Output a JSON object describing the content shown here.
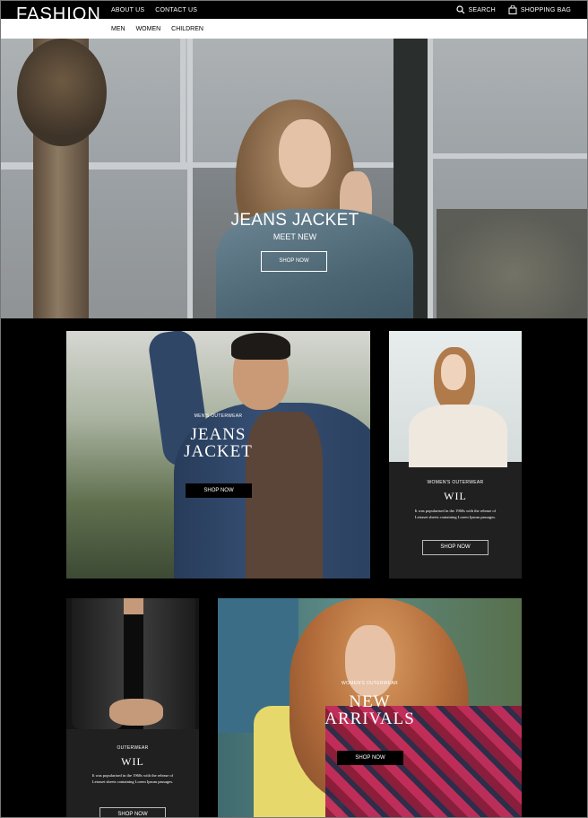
{
  "brand": {
    "logo": "FASHION"
  },
  "topnav": {
    "about": "ABOUT US",
    "contact": "CONTACT US"
  },
  "actions": {
    "search": "SEARCH",
    "bag": "SHOPPING BAG"
  },
  "subnav": {
    "men": "MEN",
    "women": "WOMEN",
    "children": "CHILDREN"
  },
  "hero": {
    "title": "JEANS JACKET",
    "subtitle": "MEET NEW",
    "cta": "SHOP NOW"
  },
  "cards": {
    "mens": {
      "category": "MEN'S OUTERWEAR",
      "title_line1": "JEANS",
      "title_line2": "JACKET",
      "cta": "SHOP NOW"
    },
    "womens": {
      "category": "WOMEN'S OUTERWEAR",
      "title": "WIL",
      "text_line1": "It was popularised in the 1960s with the release of",
      "text_line2": "Letraset sheets containing Lorem Ipsum passages.",
      "cta": "SHOP NOW"
    },
    "outerwear": {
      "category": "OUTERWEAR",
      "title": "WIL",
      "text_line1": "It was popularised in the 1960s with the release of",
      "text_line2": "Letraset sheets containing Lorem Ipsum passages.",
      "cta": "SHOP NOW"
    },
    "arrivals": {
      "category": "WOMEN'S OUTERWEAR",
      "title_line1": "NEW",
      "title_line2": "ARRIVALS",
      "cta": "SHOP NOW"
    }
  }
}
